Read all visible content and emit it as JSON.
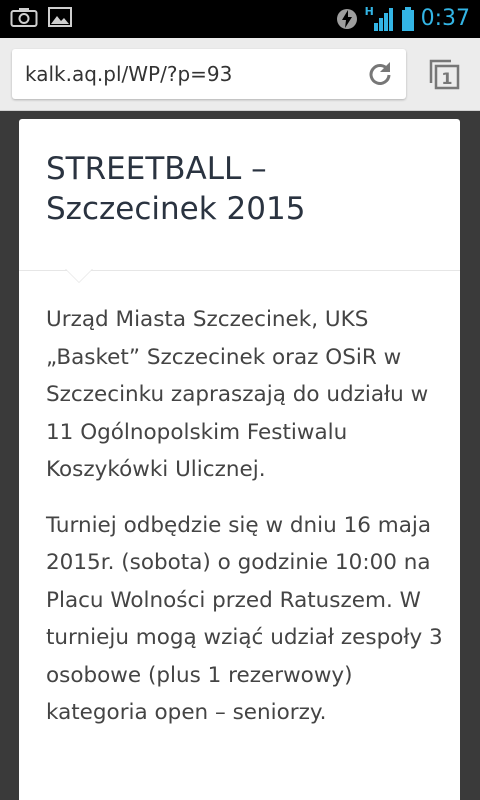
{
  "status_bar": {
    "left_icons": [
      "camera-icon",
      "gallery-icon"
    ],
    "right_icons": [
      "data-saver-icon",
      "hspa-signal-icon",
      "signal-bars-icon",
      "battery-icon"
    ],
    "network_label": "H",
    "time": "0:37",
    "accent_color": "#33b5e5"
  },
  "browser": {
    "url": "kalk.aq.pl/WP/?p=93",
    "tab_count": "1"
  },
  "article": {
    "title": "STREETBALL – Szczecinek 2015",
    "paragraphs": [
      "Urząd Miasta Szczecinek, UKS „Basket” Szczecinek oraz OSiR w Szczecinku zapraszają do udziału w 11 Ogólnopolskim Festiwalu Koszykówki Ulicznej.",
      "Turniej odbędzie się w dniu 16 maja 2015r. (sobota) o godzinie 10:00 na Placu Wolności przed Ratuszem. W turnieju mogą wziąć udział zespoły 3 osobowe (plus 1 rezerwowy) kategoria open – seniorzy."
    ]
  }
}
